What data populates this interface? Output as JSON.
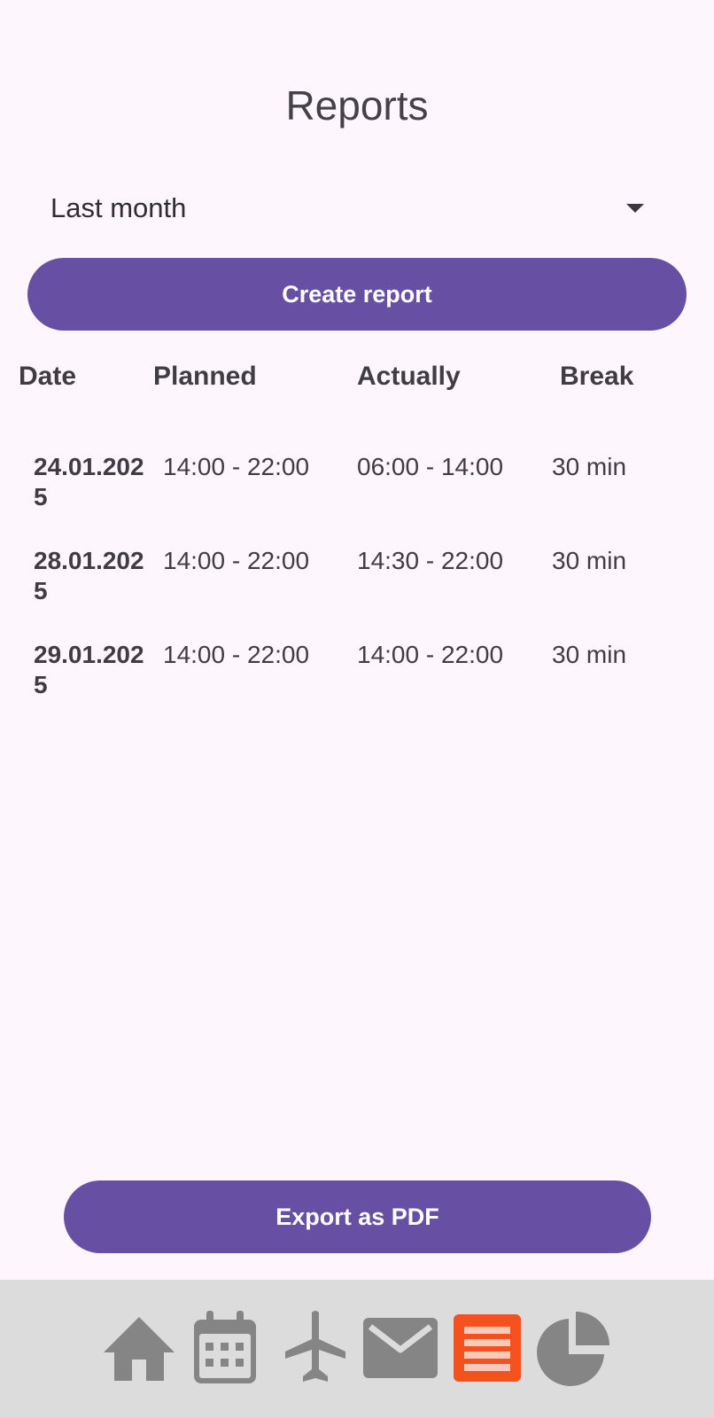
{
  "header": {
    "title": "Reports"
  },
  "period_select": {
    "value": "Last month"
  },
  "actions": {
    "create_report": "Create report",
    "export_pdf": "Export as PDF"
  },
  "table": {
    "headers": {
      "date": "Date",
      "planned": "Planned",
      "actually": "Actually",
      "break": "Break"
    },
    "rows": [
      {
        "date": "24.01.2025",
        "planned": "14:00 - 22:00",
        "actually": "06:00 - 14:00",
        "break": "30 min"
      },
      {
        "date": "28.01.2025",
        "planned": "14:00 - 22:00",
        "actually": "14:30 - 22:00",
        "break": "30 min"
      },
      {
        "date": "29.01.2025",
        "planned": "14:00 - 22:00",
        "actually": "14:00 - 22:00",
        "break": "30 min"
      }
    ]
  },
  "bottom_nav": {
    "items": [
      {
        "icon": "home-icon",
        "active": false
      },
      {
        "icon": "calendar-icon",
        "active": false
      },
      {
        "icon": "airplane-icon",
        "active": false
      },
      {
        "icon": "mail-icon",
        "active": false
      },
      {
        "icon": "list-icon",
        "active": true
      },
      {
        "icon": "pie-chart-icon",
        "active": false
      }
    ],
    "icon_color": "#858585",
    "active_color": "#f4511e"
  },
  "colors": {
    "background": "#fdf6fd",
    "primary": "#6750a4",
    "nav_background": "#dcdcdc"
  }
}
